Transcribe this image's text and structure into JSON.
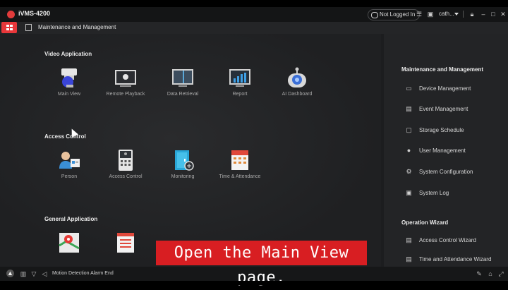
{
  "app": {
    "title": "iVMS-4200"
  },
  "titlebar": {
    "login_status": "Not Logged In",
    "user": "cath...",
    "icons": [
      "cloud-icon",
      "list-icon",
      "image-icon",
      "user-icon",
      "lock-icon",
      "minimize-icon",
      "maximize-icon",
      "close-icon"
    ]
  },
  "nav": {
    "title": "Maintenance and Management"
  },
  "sections": {
    "video": {
      "title": "Video Application",
      "modules": [
        "Main View",
        "Remote Playback",
        "Data Retrieval",
        "Report",
        "AI Dashboard"
      ]
    },
    "access": {
      "title": "Access Control",
      "modules": [
        "Person",
        "Access Control",
        "Monitoring",
        "Time & Attendance"
      ]
    },
    "general": {
      "title": "General Application"
    }
  },
  "right_panel": {
    "maintenance_title": "Maintenance and Management",
    "maintenance_items": [
      "Device Management",
      "Event Management",
      "Storage Schedule",
      "User Management",
      "System Configuration",
      "System Log"
    ],
    "wizard_title": "Operation Wizard",
    "wizard_items": [
      "Access Control Wizard",
      "Time and Attendance Wizard"
    ]
  },
  "statusbar": {
    "message": "Motion Detection Alarm End"
  },
  "caption": "Open the Main View page.",
  "colors": {
    "accent": "#e8373a",
    "caption_bg": "#d81e22",
    "background": "#1c1d1f"
  }
}
